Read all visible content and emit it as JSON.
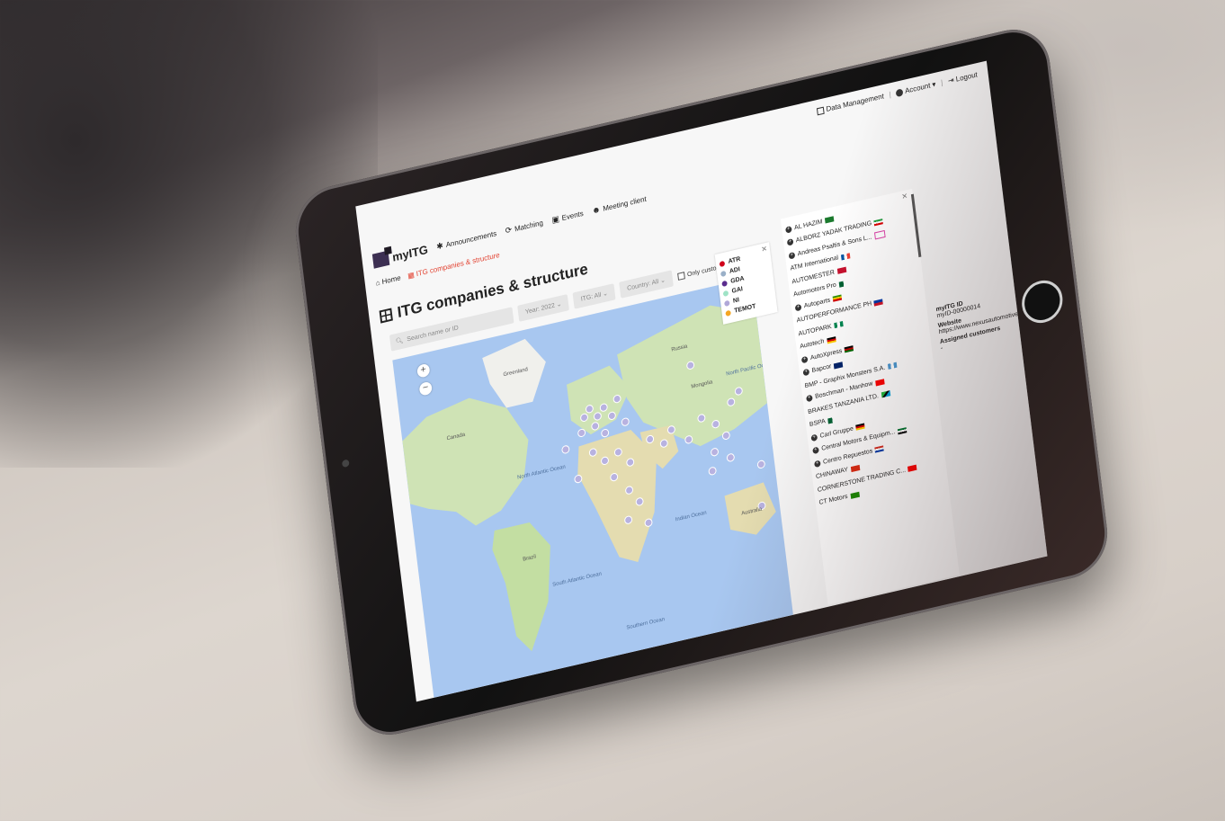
{
  "topbar": {
    "data_management": "Data Management",
    "account": "Account ▾",
    "logout": "Logout"
  },
  "brand": {
    "name": "myITG"
  },
  "nav": [
    {
      "label": "Announcements",
      "icon": "megaphone-icon"
    },
    {
      "label": "Matching",
      "icon": "matching-icon"
    },
    {
      "label": "Events",
      "icon": "calendar-icon"
    },
    {
      "label": "Meeting client",
      "icon": "people-icon"
    }
  ],
  "breadcrumb": {
    "home": "Home",
    "current": "ITG companies & structure"
  },
  "page": {
    "title": "ITG companies & structure"
  },
  "filters": {
    "search_placeholder": "Search name or ID",
    "year": "Year: 2022",
    "itg": "ITG: All",
    "country": "Country: All",
    "only_customer": "Only customer"
  },
  "map": {
    "labels": [
      "Greenland",
      "Russia",
      "North Atlantic Ocean",
      "South Atlantic Ocean",
      "Indian Ocean",
      "Southern Ocean",
      "Australia",
      "North Pacific Ocean",
      "Brazil",
      "Mongolia",
      "Canada"
    ],
    "zoom_in": "+",
    "zoom_out": "−"
  },
  "legend": [
    {
      "label": "ATR",
      "color": "#d0021b"
    },
    {
      "label": "ADI",
      "color": "#9ab0c8"
    },
    {
      "label": "GDA",
      "color": "#5b2d8e"
    },
    {
      "label": "GAI",
      "color": "#9fe3c6"
    },
    {
      "label": "NI",
      "color": "#b0a8d8"
    },
    {
      "label": "TEMOT",
      "color": "#f5a623"
    }
  ],
  "companies": [
    {
      "name": "AL HAZIM",
      "flag": "sa",
      "expandable": true
    },
    {
      "name": "ALBORZ YADAK TRADING",
      "flag": "ir",
      "expandable": true
    },
    {
      "name": "Andreas Psaltis & Sons L...",
      "flag": "cy",
      "expandable": true
    },
    {
      "name": "ATM International",
      "flag": "fr",
      "expandable": false
    },
    {
      "name": "AUTOMESTER",
      "flag": "dk",
      "expandable": false
    },
    {
      "name": "Automotors Pro",
      "flag": "dz",
      "expandable": false
    },
    {
      "name": "Autoparts",
      "flag": "zw",
      "expandable": true
    },
    {
      "name": "AUTOPERFORMANCE PH",
      "flag": "ph",
      "expandable": false
    },
    {
      "name": "AUTOPARK",
      "flag": "ng",
      "expandable": false
    },
    {
      "name": "Autotech",
      "flag": "de",
      "expandable": false
    },
    {
      "name": "AutoXpress",
      "flag": "ke",
      "expandable": true
    },
    {
      "name": "Bapcor",
      "flag": "au",
      "expandable": true
    },
    {
      "name": "BMP - Graphix Monsters S.A.",
      "flag": "gt",
      "expandable": false
    },
    {
      "name": "Boschman - Manhow",
      "flag": "tw",
      "expandable": true
    },
    {
      "name": "BRAKES TANZANIA LTD.",
      "flag": "tz",
      "expandable": false
    },
    {
      "name": "BSPA",
      "flag": "dz",
      "expandable": false
    },
    {
      "name": "Carl Gruppe",
      "flag": "de",
      "expandable": true
    },
    {
      "name": "Central Motors & Equipm...",
      "flag": "ae",
      "expandable": true
    },
    {
      "name": "Centro Repuestos",
      "flag": "py",
      "expandable": true
    },
    {
      "name": "CHINAWAY",
      "flag": "cn",
      "expandable": false
    },
    {
      "name": "CORNERSTONE TRADING C...",
      "flag": "tw",
      "expandable": false
    },
    {
      "name": "CT Motors",
      "flag": "zm",
      "expandable": false
    }
  ],
  "detail": {
    "id_label": "myITG ID",
    "id_value": "myID-00000014",
    "website_label": "Website",
    "website_value": "https://www.nexusautomotiveinternational.eu",
    "assigned_label": "Assigned customers",
    "assigned_value": "-"
  }
}
